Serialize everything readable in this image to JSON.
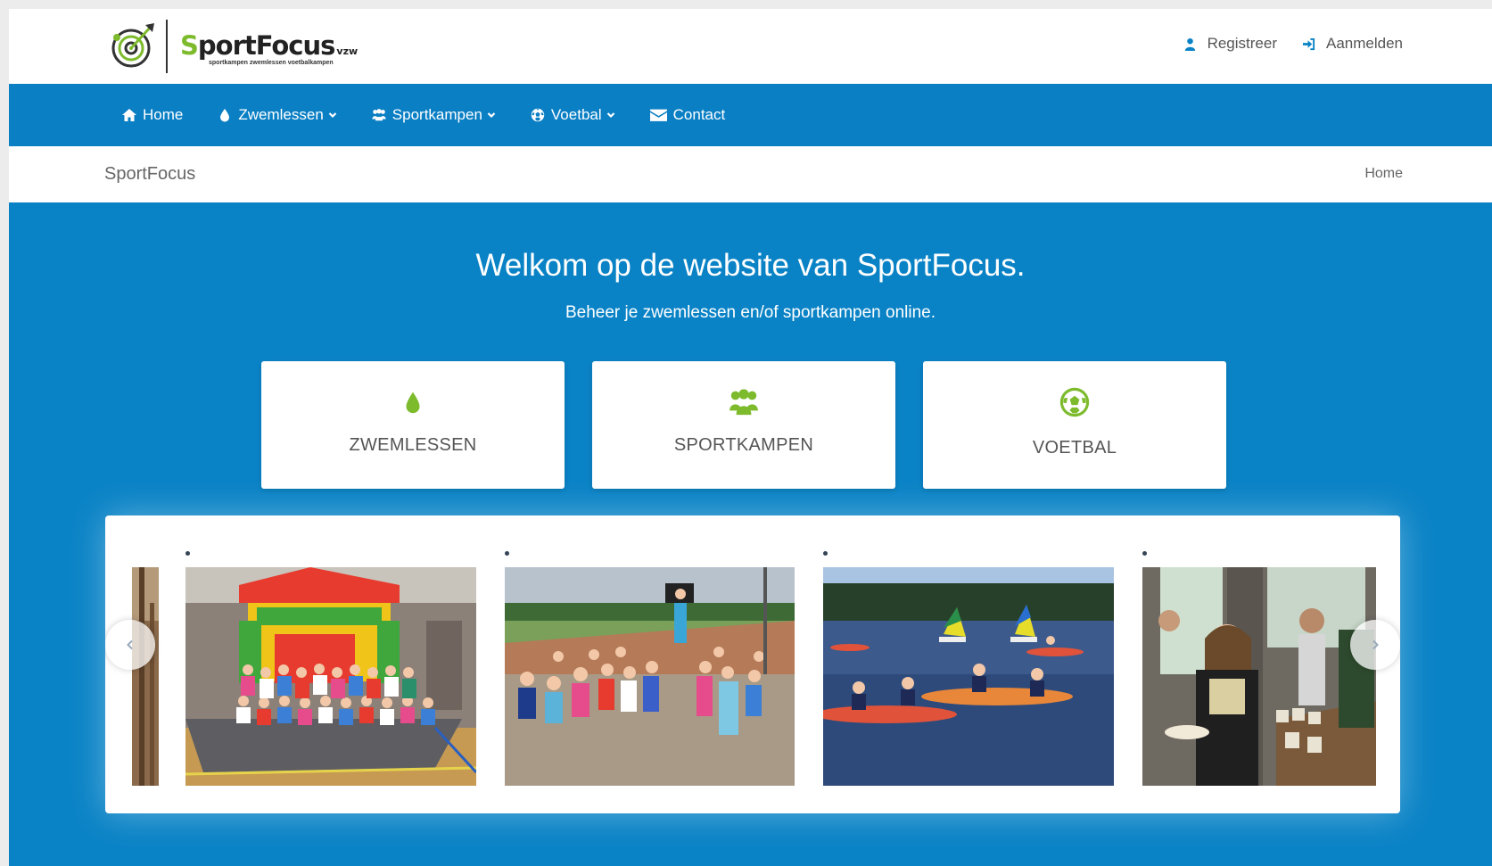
{
  "header": {
    "logo": {
      "word_s": "S",
      "word_rest": "portFocus",
      "suffix": "vzw",
      "tagline": "sportkampen zwemlessen voetbalkampen"
    },
    "user_links": [
      {
        "label": "Registreer",
        "icon": "user-icon"
      },
      {
        "label": "Aanmelden",
        "icon": "sign-in-icon"
      }
    ]
  },
  "nav": {
    "items": [
      {
        "label": "Home",
        "icon": "home-icon",
        "dropdown": false
      },
      {
        "label": "Zwemlessen",
        "icon": "drop-icon",
        "dropdown": true
      },
      {
        "label": "Sportkampen",
        "icon": "users-icon",
        "dropdown": true
      },
      {
        "label": "Voetbal",
        "icon": "soccer-ball-icon",
        "dropdown": true
      },
      {
        "label": "Contact",
        "icon": "envelope-icon",
        "dropdown": false
      }
    ]
  },
  "breadcrumb": {
    "title": "SportFocus",
    "home": "Home"
  },
  "hero": {
    "title": "Welkom op de website van SportFocus.",
    "subtitle": "Beheer je zwemlessen en/of sportkampen online."
  },
  "cards": [
    {
      "label": "ZWEMLESSEN",
      "icon": "drop-icon"
    },
    {
      "label": "SPORTKAMPEN",
      "icon": "users-icon"
    },
    {
      "label": "VOETBAL",
      "icon": "soccer-ball-icon"
    }
  ],
  "carousel": {
    "slides": [
      {
        "subject": "bouncy-castle-photo"
      },
      {
        "subject": "kids-outdoor-photo"
      },
      {
        "subject": "kayak-lake-photo"
      },
      {
        "subject": "kitchen-photo"
      }
    ]
  },
  "colors": {
    "brand_blue": "#0a83c6",
    "accent_green": "#7dbb2d"
  }
}
